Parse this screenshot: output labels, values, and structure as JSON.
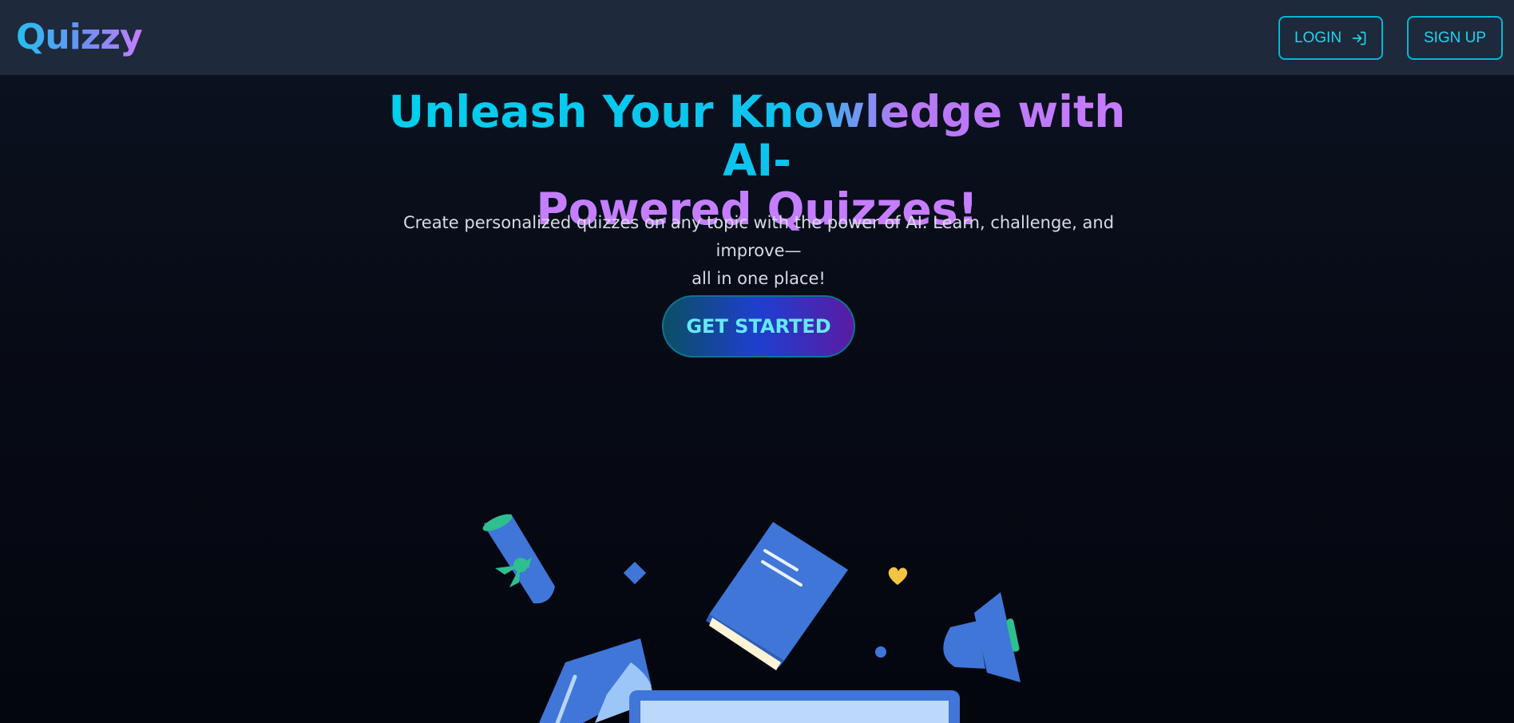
{
  "header": {
    "logo": "Quizzy",
    "login_label": "LOGIN",
    "signup_label": "SIGN UP",
    "login_icon": "login-arrow-icon"
  },
  "hero": {
    "title_line1": "Unleash Your Knowledge with AI-",
    "title_line2": "Powered Quizzes!",
    "subtitle_line1": "Create personalized quizzes on any topic with the power of AI. Learn, challenge, and improve—",
    "subtitle_line2": "all in one place!",
    "cta_label": "GET STARTED"
  },
  "colors": {
    "accent_cyan": "#22d3ee",
    "accent_purple": "#c77dff",
    "illustration_blue": "#3f76d8",
    "header_bg": "#1e293b"
  }
}
